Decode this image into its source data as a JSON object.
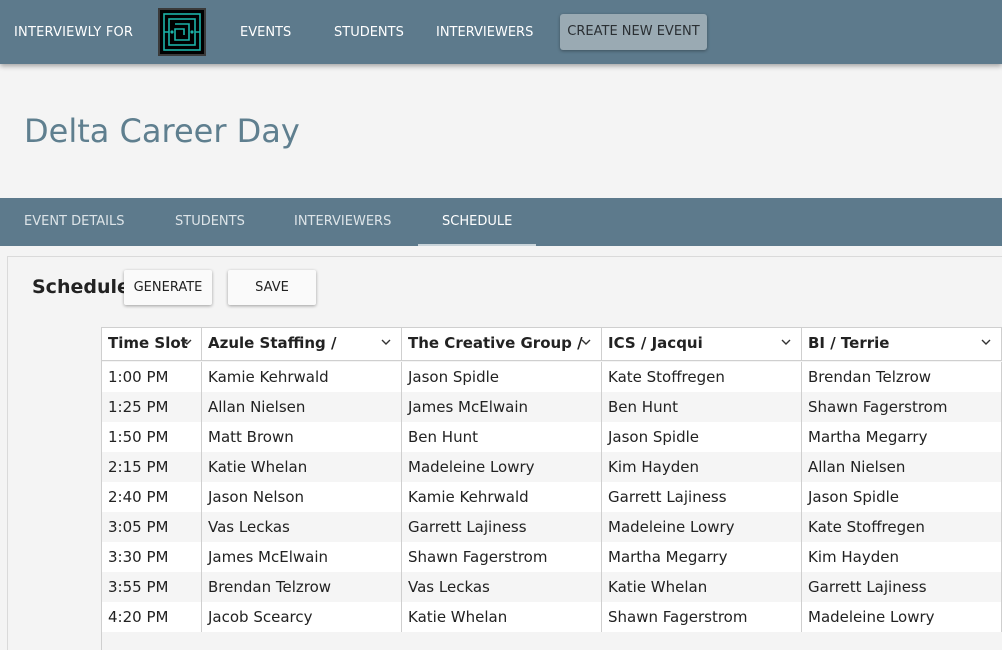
{
  "app": {
    "brand": "INTERVIEWLY FOR"
  },
  "nav": {
    "events": "EVENTS",
    "students": "STUDENTS",
    "interviewers": "INTERVIEWERS",
    "create": "CREATE NEW EVENT"
  },
  "page": {
    "title": "Delta Career Day"
  },
  "tabs": [
    {
      "label": "EVENT DETAILS"
    },
    {
      "label": "STUDENTS"
    },
    {
      "label": "INTERVIEWERS"
    },
    {
      "label": "SCHEDULE",
      "active": true
    }
  ],
  "schedule": {
    "title": "Schedule",
    "generate_label": "GENERATE",
    "save_label": "SAVE",
    "columns": [
      "Time Slot",
      "Azule Staffing /",
      "The Creative Group /",
      "ICS / Jacqui",
      "BI / Terrie"
    ],
    "rows": [
      [
        "1:00 PM",
        "Kamie Kehrwald",
        "Jason Spidle",
        "Kate Stoffregen",
        "Brendan Telzrow"
      ],
      [
        "1:25 PM",
        "Allan Nielsen",
        "James McElwain",
        "Ben Hunt",
        "Shawn Fagerstrom"
      ],
      [
        "1:50 PM",
        "Matt Brown",
        "Ben Hunt",
        "Jason Spidle",
        "Martha Megarry"
      ],
      [
        "2:15 PM",
        "Katie Whelan",
        "Madeleine Lowry",
        "Kim Hayden",
        "Allan Nielsen"
      ],
      [
        "2:40 PM",
        "Jason Nelson",
        "Kamie Kehrwald",
        "Garrett Lajiness",
        "Jason Spidle"
      ],
      [
        "3:05 PM",
        "Vas Leckas",
        "Garrett Lajiness",
        "Madeleine Lowry",
        "Kate Stoffregen"
      ],
      [
        "3:30 PM",
        "James McElwain",
        "Shawn Fagerstrom",
        "Martha Megarry",
        "Kim Hayden"
      ],
      [
        "3:55 PM",
        "Brendan Telzrow",
        "Vas Leckas",
        "Katie Whelan",
        "Garrett Lajiness"
      ],
      [
        "4:20 PM",
        "Jacob Scearcy",
        "Katie Whelan",
        "Shawn Fagerstrom",
        "Madeleine Lowry"
      ]
    ]
  },
  "colors": {
    "primary": "#5d7a8c",
    "title": "#5f7f8f",
    "logo_accent": "#1bb3a8"
  },
  "icons": {
    "logo": "maze-logo-icon",
    "column_menu": "chevron-down-icon"
  }
}
